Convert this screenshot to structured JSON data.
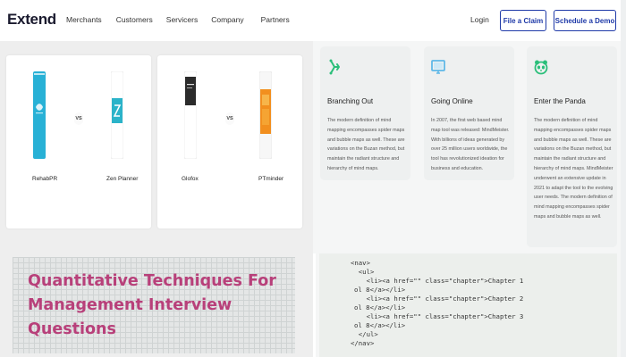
{
  "header": {
    "logo": "Extend",
    "nav": [
      "Merchants",
      "Customers",
      "Servicers",
      "Company",
      "Partners"
    ],
    "login": "Login",
    "file_claim": "File a Claim",
    "schedule_demo": "Schedule a Demo"
  },
  "comparisons": [
    {
      "vs": "VS",
      "left": {
        "name": "RehabPR",
        "color": "#28b1d6"
      },
      "right": {
        "name": "Zen Planner",
        "color": "#2bb3c9"
      }
    },
    {
      "vs": "VS",
      "left": {
        "name": "Glofox",
        "color": "#2b2b2b"
      },
      "right": {
        "name": "PTminder",
        "color": "#f28f1e"
      }
    }
  ],
  "features": [
    {
      "icon": "branch-icon",
      "color": "#2bbf7a",
      "title": "Branching Out",
      "text": "The modern definition of mind mapping encompasses spider maps and bubble maps as well. These are variations on the Buzan method, but maintain the radiant structure and hierarchy of mind maps."
    },
    {
      "icon": "monitor-icon",
      "color": "#5fb8e8",
      "title": "Going Online",
      "text": "In 2007, the first web based mind map tool was released: MindMeister. With billions of ideas generated by over 25 million users worldwide, the tool has revolutionized ideation for business and education."
    },
    {
      "icon": "panda-icon",
      "color": "#2bbf7a",
      "title": "Enter the Panda",
      "text": "The modern definition of mind mapping encompasses spider maps and bubble maps as well. These are variations on the Buzan method, but maintain the radiant structure and hierarchy of mind maps. MindMeister underwent an extensive update in 2021 to adapt the tool to the evolving user needs. The modern definition of mind mapping encompasses spider maps and bubble maps as well."
    }
  ],
  "banner": {
    "title": "Quantitative Techniques For Management Interview Questions"
  },
  "code": {
    "lines": [
      "<nav>",
      "  <ul>",
      "    <li><a href=\"\" class=\"chapter\">Chapter 1",
      "ol 8</a></li>",
      "    <li><a href=\"\" class=\"chapter\">Chapter 2",
      "ol 8</a></li>",
      "    <li><a href=\"\" class=\"chapter\">Chapter 3",
      "ol 8</a></li>",
      "  </ul>",
      "</nav>"
    ]
  }
}
